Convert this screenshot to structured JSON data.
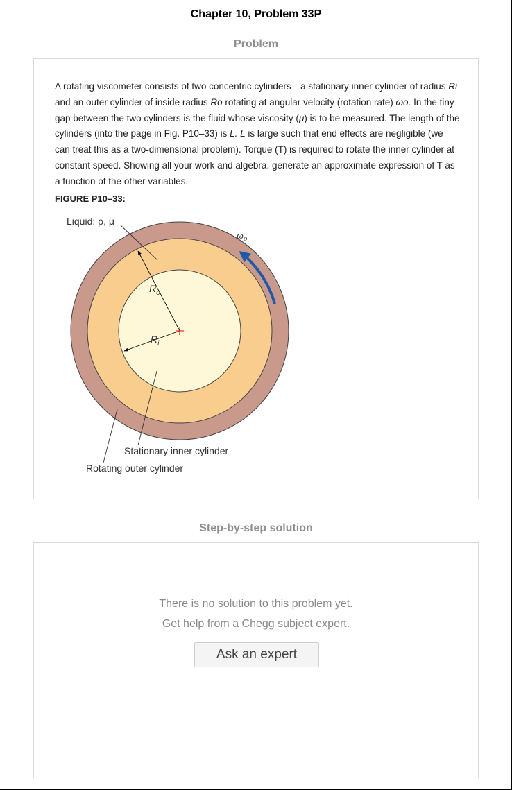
{
  "page": {
    "title": "Chapter 10, Problem 33P",
    "problem_label": "Problem",
    "solution_label": "Step-by-step solution"
  },
  "problem": {
    "paragraph_parts": [
      "A rotating viscometer consists of two concentric cylinders—a stationary inner cylinder of radius ",
      "Ri",
      " and an outer cylinder of inside radius ",
      "Ro",
      " rotating at angular velocity (rotation rate) ",
      "ωo.",
      " In the tiny gap between the two cylinders is the fluid whose viscosity (",
      "μ",
      ") is to be measured. The length of the cylinders (into the page in Fig. P10–33) is ",
      "L. L",
      " is large such that end effects are negligible (we can treat this as a two-dimensional problem). Torque (T) is required to rotate the inner cylinder at constant speed. Showing all your work and algebra, generate an approximate expression of T as a function of the other variables."
    ],
    "figure_label": "FIGURE P10–33:"
  },
  "figure": {
    "liquid_label": "Liquid: ρ, μ",
    "omega_label": "ω",
    "omega_sub": "o",
    "ro_label": "R",
    "ro_sub": "o",
    "ri_label": "R",
    "ri_sub": "i",
    "inner_label": "Stationary inner cylinder",
    "outer_label": "Rotating outer cylinder",
    "colors": {
      "outer_wall": "#c9998b",
      "liquid": "#f9cd8e",
      "inner": "#fff8d8",
      "arrow_blue": "#1e5aa8",
      "center_mark": "#e0302a"
    }
  },
  "solution": {
    "empty_line1": "There is no solution to this problem yet.",
    "empty_line2": "Get help from a Chegg subject expert.",
    "ask_button": "Ask an expert"
  }
}
